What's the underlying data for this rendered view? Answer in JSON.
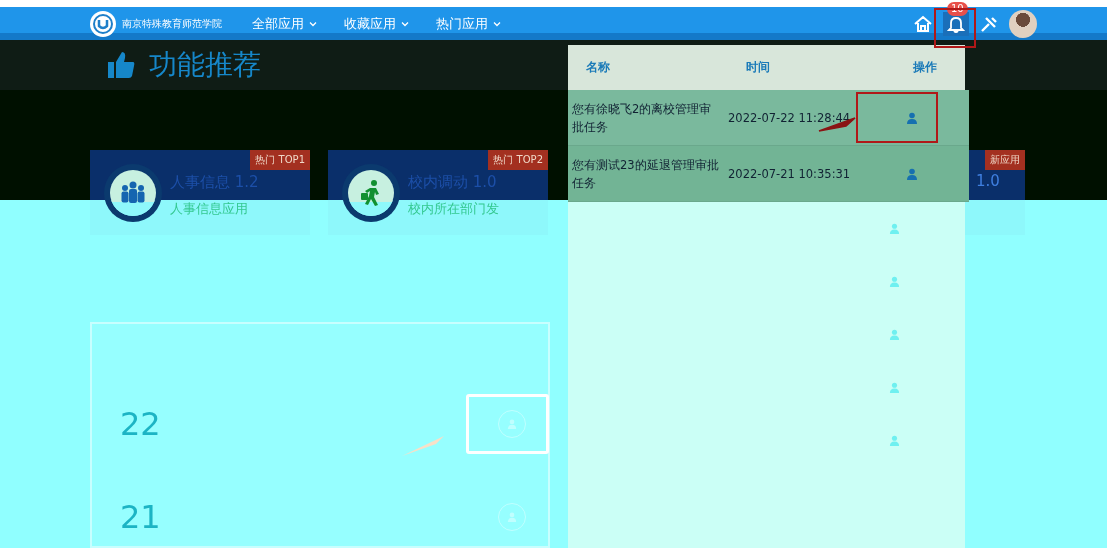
{
  "nav": {
    "school_name": "南京特殊教育师范学院",
    "menus": [
      {
        "label": "全部应用"
      },
      {
        "label": "收藏应用"
      },
      {
        "label": "热门应用"
      }
    ],
    "notification_count": "10"
  },
  "section_title": "功能推荐",
  "cards": [
    {
      "kind": "full",
      "title": "人事信息 1.2",
      "subtitle": "人事信息应用",
      "tag": "热门 TOP1"
    },
    {
      "kind": "full",
      "title": "校内调动 1.0",
      "subtitle": "校内所在部门发",
      "tag": "热门 TOP2"
    },
    {
      "kind": "partial",
      "title": "1.0",
      "tag": "新应用"
    }
  ],
  "popup": {
    "columns": [
      "名称",
      "时间",
      "操作"
    ],
    "rows": [
      {
        "name": "您有徐晓飞2的离校管理审批任务",
        "time": "2022-07-22 11:28:44",
        "highlighted": true
      },
      {
        "name": "您有测试23的延退管理审批任务",
        "time": "2022-07-21 10:35:31",
        "highlighted": false
      }
    ]
  },
  "tasks": [
    {
      "day": "22",
      "highlighted": true
    },
    {
      "day": "21",
      "highlighted": false
    }
  ]
}
